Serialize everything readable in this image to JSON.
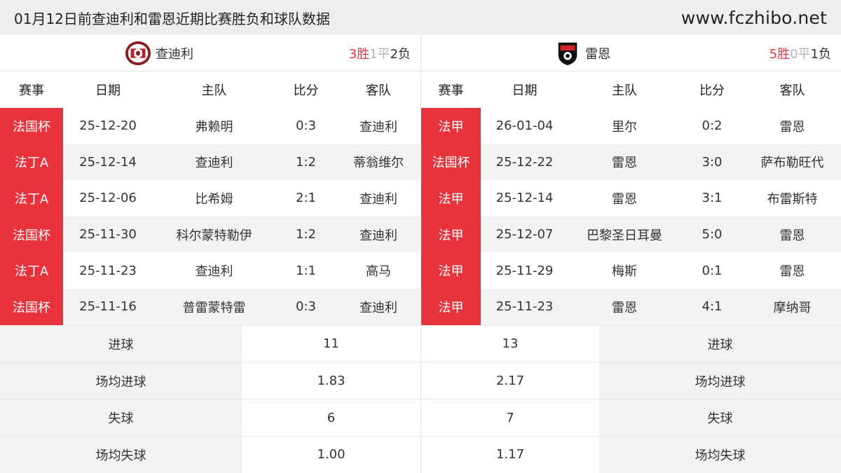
{
  "header": {
    "title": "01月12日前查迪利和雷恩近期比赛胜负和球队数据",
    "site": "www.fczhibo.net"
  },
  "left": {
    "team": "查迪利",
    "record": {
      "wins": "3胜",
      "draws": "1平",
      "losses": "2负"
    },
    "columns": [
      "赛事",
      "日期",
      "主队",
      "比分",
      "客队"
    ],
    "matches": [
      {
        "comp": "法国杯",
        "date": "25-12-20",
        "home": "弗赖明",
        "score": "0:3",
        "away": "查迪利"
      },
      {
        "comp": "法丁A",
        "date": "25-12-14",
        "home": "查迪利",
        "score": "1:2",
        "away": "蒂翁维尔"
      },
      {
        "comp": "法丁A",
        "date": "25-12-06",
        "home": "比希姆",
        "score": "2:1",
        "away": "查迪利"
      },
      {
        "comp": "法国杯",
        "date": "25-11-30",
        "home": "科尔蒙特勒伊",
        "score": "1:2",
        "away": "查迪利"
      },
      {
        "comp": "法丁A",
        "date": "25-11-23",
        "home": "查迪利",
        "score": "1:1",
        "away": "高马"
      },
      {
        "comp": "法国杯",
        "date": "25-11-16",
        "home": "普雷蒙特雷",
        "score": "0:3",
        "away": "查迪利"
      }
    ]
  },
  "right": {
    "team": "雷恩",
    "record": {
      "wins": "5胜",
      "draws": "0平",
      "losses": "1负"
    },
    "columns": [
      "赛事",
      "日期",
      "主队",
      "比分",
      "客队"
    ],
    "matches": [
      {
        "comp": "法甲",
        "date": "26-01-04",
        "home": "里尔",
        "score": "0:2",
        "away": "雷恩"
      },
      {
        "comp": "法国杯",
        "date": "25-12-22",
        "home": "雷恩",
        "score": "3:0",
        "away": "萨布勒旺代"
      },
      {
        "comp": "法甲",
        "date": "25-12-14",
        "home": "雷恩",
        "score": "3:1",
        "away": "布雷斯特"
      },
      {
        "comp": "法甲",
        "date": "25-12-07",
        "home": "巴黎圣日耳曼",
        "score": "5:0",
        "away": "雷恩"
      },
      {
        "comp": "法甲",
        "date": "25-11-29",
        "home": "梅斯",
        "score": "0:1",
        "away": "雷恩"
      },
      {
        "comp": "法甲",
        "date": "25-11-23",
        "home": "雷恩",
        "score": "4:1",
        "away": "摩纳哥"
      }
    ]
  },
  "stats": [
    {
      "label": "进球",
      "left": "11",
      "right": "13"
    },
    {
      "label": "场均进球",
      "left": "1.83",
      "right": "2.17"
    },
    {
      "label": "失球",
      "left": "6",
      "right": "7"
    },
    {
      "label": "场均失球",
      "left": "1.00",
      "right": "1.17"
    }
  ],
  "colors": {
    "accent": "#e8323c",
    "draw": "#b5b5b5",
    "stripe": "#f2f2f2",
    "topbar": "#eeeeee"
  },
  "icons": {
    "left_logo": "chantilly-crest-icon",
    "right_logo": "rennes-crest-icon"
  }
}
